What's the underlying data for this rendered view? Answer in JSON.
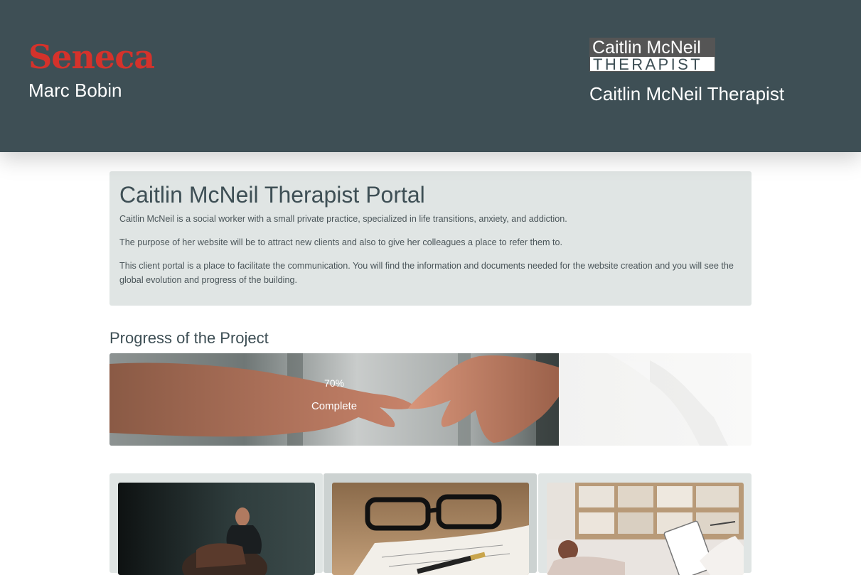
{
  "header": {
    "school_logo_text": "Seneca",
    "student_name": "Marc Bobin",
    "client_logo_top": "Caitlin McNeil",
    "client_logo_bottom": "THERAPIST",
    "client_name": "Caitlin McNeil Therapist"
  },
  "intro": {
    "title": "Caitlin McNeil Therapist Portal",
    "paragraphs": [
      "Caitlin McNeil is a social worker with a small private practice, specialized in life transitions, anxiety, and addiction.",
      "The purpose of her website will be to attract new clients and also to give her colleagues a place to refer them to.",
      "This client portal is a place to facilitate the communication. You will find the information and documents needed for the website creation and you will see the global evolution and progress of the building."
    ]
  },
  "progress": {
    "title": "Progress of the Project",
    "percent_label": "70%",
    "status_label": "Complete",
    "value": 0.7
  },
  "cards": [
    {
      "image": "person-on-couch-photo"
    },
    {
      "image": "glasses-notebook-photo"
    },
    {
      "image": "therapy-session-photo"
    }
  ],
  "colors": {
    "header_bg": "#3e4f55",
    "brand_red": "#d5322b",
    "panel_bg": "#e0e5e4",
    "heading": "#3e4f55"
  }
}
